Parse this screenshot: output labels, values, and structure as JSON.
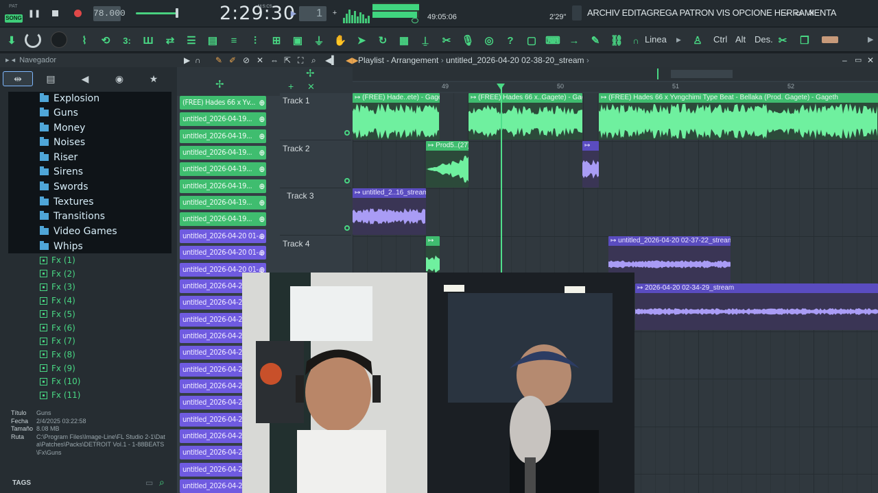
{
  "transport": {
    "mode_pat": "PAT",
    "mode_song": "SONG",
    "tempo": "78.000",
    "time": "2:29:30",
    "time_unit": "M:S:CS",
    "pattern": "1",
    "cpu_time": "49:05:06",
    "pos_readout": "2'29\""
  },
  "menu": "ARCHIV EDITAGREGA PATRON VIS OPCIONE HERRAMIENTA",
  "window_controls": [
    "–",
    "▭",
    "✕"
  ],
  "toolbar": {
    "line_label": "Linea",
    "ctrl": "Ctrl",
    "alt": "Alt",
    "des": "Des."
  },
  "browser": {
    "title": "Navegador",
    "folders": [
      "Explosion",
      "Guns",
      "Money",
      "Noises",
      "Riser",
      "Sirens",
      "Swords",
      "Textures",
      "Transitions",
      "Video Games",
      "Whips"
    ],
    "fx_items": [
      "Fx (1)",
      "Fx (2)",
      "Fx (3)",
      "Fx (4)",
      "Fx (5)",
      "Fx (6)",
      "Fx (7)",
      "Fx (8)",
      "Fx (9)",
      "Fx (10)",
      "Fx (11)"
    ],
    "info": {
      "title_label": "Título",
      "title_value": "Guns",
      "date_label": "Fecha",
      "date_value": "2/4/2025 03:22:58",
      "size_label": "Tamaño",
      "size_value": "8.08 MB",
      "path_label": "Ruta",
      "path_value": "C:\\Program Files\\Image-Line\\FL Studio 2-1\\Data\\Patches\\Packs\\DETROIT Vol.1 - 1-88BEATS\\Fx\\Guns"
    },
    "tags_label": "TAGS"
  },
  "playlist": {
    "title": "Playlist - Arrangement",
    "project": "untitled_2026-04-20 02-38-20_stream",
    "clips_list": [
      {
        "label": "(FREE) Hades 66 x Yv...",
        "color": "green"
      },
      {
        "label": "untitled_2026-04-19...",
        "color": "green"
      },
      {
        "label": "untitled_2026-04-19...",
        "color": "green"
      },
      {
        "label": "untitled_2026-04-19...",
        "color": "green"
      },
      {
        "label": "untitled_2026-04-19...",
        "color": "green"
      },
      {
        "label": "untitled_2026-04-19...",
        "color": "green"
      },
      {
        "label": "untitled_2026-04-19...",
        "color": "green"
      },
      {
        "label": "untitled_2026-04-19...",
        "color": "green"
      },
      {
        "label": "untitled_2026-04-20 01-...",
        "color": "purple"
      },
      {
        "label": "untitled_2026-04-20 01-...",
        "color": "purple"
      },
      {
        "label": "untitled_2026-04-20 01-...",
        "color": "purple"
      },
      {
        "label": "untitled_2026-04-2",
        "color": "purple"
      },
      {
        "label": "untitled_2026-04-2",
        "color": "purple"
      },
      {
        "label": "untitled_2026-04-2",
        "color": "purple"
      },
      {
        "label": "untitled_2026-04-2",
        "color": "purple"
      },
      {
        "label": "untitled_2026-04-2",
        "color": "purple"
      },
      {
        "label": "untitled_2026-04-2",
        "color": "purple"
      },
      {
        "label": "untitled_2026-04-2",
        "color": "purple"
      },
      {
        "label": "untitled_2026-04-2",
        "color": "purple"
      },
      {
        "label": "untitled_2026-04-2",
        "color": "purple"
      },
      {
        "label": "untitled_2026-04-2",
        "color": "purple"
      },
      {
        "label": "untitled_2026-04-2",
        "color": "purple"
      },
      {
        "label": "untitled_2026-04-2",
        "color": "purple"
      },
      {
        "label": "untitled_2026-04-2",
        "color": "purple"
      },
      {
        "label": "untitled_2026-04-2",
        "color": "purple"
      }
    ],
    "tracks": [
      "Track 1",
      "Track 2",
      "Track 3",
      "Track 4"
    ],
    "ruler": [
      "49",
      "50",
      "51",
      "52"
    ],
    "arr_clips": {
      "t1a": "(FREE) Hade..ete) - Gageth",
      "t1b": "(FREE) Hades 66 x..Gagete) - Gageth",
      "t1c": "(FREE) Hades 66 x Yvngchimi Type Beat - Bellaka (Prod. Gagete) - Gageth",
      "t2a": "Prod5..(27)",
      "t3a": "untitled_2..16_stream",
      "t4b": "untitled_2026-04-20 02-37-22_stream",
      "t5a": "2026-04-20 02-34-29_stream"
    }
  },
  "colors": {
    "accent_green": "#49d884",
    "clip_green": "#3fbd6f",
    "clip_purple": "#6f5be0",
    "bg": "#1c2126"
  }
}
